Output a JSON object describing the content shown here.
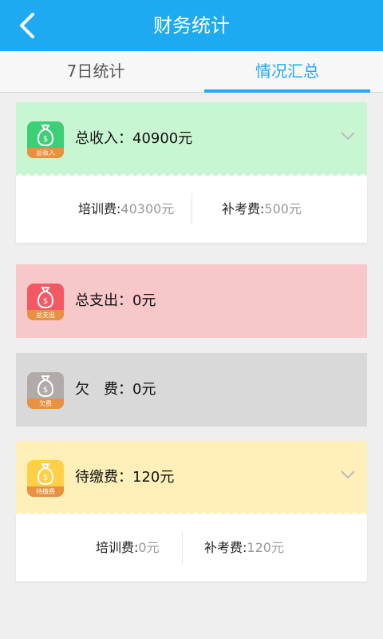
{
  "header": {
    "title": "财务统计"
  },
  "tabs": [
    {
      "label": "7日统计"
    },
    {
      "label": "情况汇总"
    }
  ],
  "cards": [
    {
      "label": "总收入：40900元",
      "icon_tag": "总收入",
      "bg": "#c8f6d3",
      "icon_color": "#3ccf76",
      "tag_color": "#e8913e",
      "rows": [
        {
          "key": "培训费:",
          "value": "40300元"
        },
        {
          "key": "补考费:",
          "value": "500元"
        }
      ]
    },
    {
      "label": "总支出：0元",
      "icon_tag": "总支出",
      "bg": "#f7c7ca",
      "icon_color": "#f35863",
      "tag_color": "#e8913e"
    },
    {
      "label": "欠　费：0元",
      "icon_tag": "欠费",
      "bg": "#d9d9d9",
      "icon_color": "#b2aaa8",
      "tag_color": "#e8913e"
    },
    {
      "label": "待缴费：120元",
      "icon_tag": "待缴费",
      "bg": "#fff0b9",
      "icon_color": "#ffcf46",
      "tag_color": "#e8913e",
      "rows": [
        {
          "key": "培训费:",
          "value": "0元"
        },
        {
          "key": "补考费:",
          "value": "120元"
        }
      ]
    }
  ]
}
